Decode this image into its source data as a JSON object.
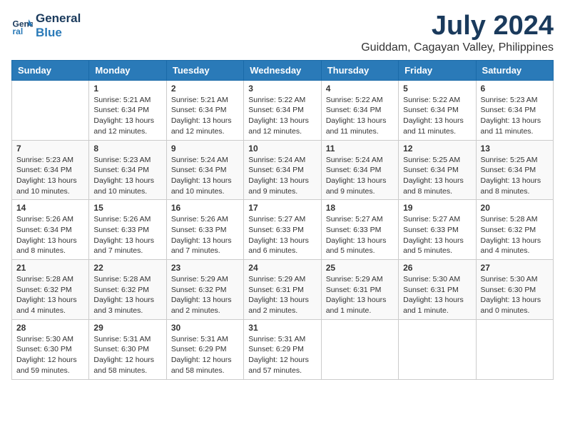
{
  "app": {
    "logo_line1": "General",
    "logo_line2": "Blue"
  },
  "header": {
    "month_year": "July 2024",
    "location": "Guiddam, Cagayan Valley, Philippines"
  },
  "weekdays": [
    "Sunday",
    "Monday",
    "Tuesday",
    "Wednesday",
    "Thursday",
    "Friday",
    "Saturday"
  ],
  "weeks": [
    [
      {
        "day": "",
        "info": ""
      },
      {
        "day": "1",
        "info": "Sunrise: 5:21 AM\nSunset: 6:34 PM\nDaylight: 13 hours\nand 12 minutes."
      },
      {
        "day": "2",
        "info": "Sunrise: 5:21 AM\nSunset: 6:34 PM\nDaylight: 13 hours\nand 12 minutes."
      },
      {
        "day": "3",
        "info": "Sunrise: 5:22 AM\nSunset: 6:34 PM\nDaylight: 13 hours\nand 12 minutes."
      },
      {
        "day": "4",
        "info": "Sunrise: 5:22 AM\nSunset: 6:34 PM\nDaylight: 13 hours\nand 11 minutes."
      },
      {
        "day": "5",
        "info": "Sunrise: 5:22 AM\nSunset: 6:34 PM\nDaylight: 13 hours\nand 11 minutes."
      },
      {
        "day": "6",
        "info": "Sunrise: 5:23 AM\nSunset: 6:34 PM\nDaylight: 13 hours\nand 11 minutes."
      }
    ],
    [
      {
        "day": "7",
        "info": "Sunrise: 5:23 AM\nSunset: 6:34 PM\nDaylight: 13 hours\nand 10 minutes."
      },
      {
        "day": "8",
        "info": "Sunrise: 5:23 AM\nSunset: 6:34 PM\nDaylight: 13 hours\nand 10 minutes."
      },
      {
        "day": "9",
        "info": "Sunrise: 5:24 AM\nSunset: 6:34 PM\nDaylight: 13 hours\nand 10 minutes."
      },
      {
        "day": "10",
        "info": "Sunrise: 5:24 AM\nSunset: 6:34 PM\nDaylight: 13 hours\nand 9 minutes."
      },
      {
        "day": "11",
        "info": "Sunrise: 5:24 AM\nSunset: 6:34 PM\nDaylight: 13 hours\nand 9 minutes."
      },
      {
        "day": "12",
        "info": "Sunrise: 5:25 AM\nSunset: 6:34 PM\nDaylight: 13 hours\nand 8 minutes."
      },
      {
        "day": "13",
        "info": "Sunrise: 5:25 AM\nSunset: 6:34 PM\nDaylight: 13 hours\nand 8 minutes."
      }
    ],
    [
      {
        "day": "14",
        "info": "Sunrise: 5:26 AM\nSunset: 6:34 PM\nDaylight: 13 hours\nand 8 minutes."
      },
      {
        "day": "15",
        "info": "Sunrise: 5:26 AM\nSunset: 6:33 PM\nDaylight: 13 hours\nand 7 minutes."
      },
      {
        "day": "16",
        "info": "Sunrise: 5:26 AM\nSunset: 6:33 PM\nDaylight: 13 hours\nand 7 minutes."
      },
      {
        "day": "17",
        "info": "Sunrise: 5:27 AM\nSunset: 6:33 PM\nDaylight: 13 hours\nand 6 minutes."
      },
      {
        "day": "18",
        "info": "Sunrise: 5:27 AM\nSunset: 6:33 PM\nDaylight: 13 hours\nand 5 minutes."
      },
      {
        "day": "19",
        "info": "Sunrise: 5:27 AM\nSunset: 6:33 PM\nDaylight: 13 hours\nand 5 minutes."
      },
      {
        "day": "20",
        "info": "Sunrise: 5:28 AM\nSunset: 6:32 PM\nDaylight: 13 hours\nand 4 minutes."
      }
    ],
    [
      {
        "day": "21",
        "info": "Sunrise: 5:28 AM\nSunset: 6:32 PM\nDaylight: 13 hours\nand 4 minutes."
      },
      {
        "day": "22",
        "info": "Sunrise: 5:28 AM\nSunset: 6:32 PM\nDaylight: 13 hours\nand 3 minutes."
      },
      {
        "day": "23",
        "info": "Sunrise: 5:29 AM\nSunset: 6:32 PM\nDaylight: 13 hours\nand 2 minutes."
      },
      {
        "day": "24",
        "info": "Sunrise: 5:29 AM\nSunset: 6:31 PM\nDaylight: 13 hours\nand 2 minutes."
      },
      {
        "day": "25",
        "info": "Sunrise: 5:29 AM\nSunset: 6:31 PM\nDaylight: 13 hours\nand 1 minute."
      },
      {
        "day": "26",
        "info": "Sunrise: 5:30 AM\nSunset: 6:31 PM\nDaylight: 13 hours\nand 1 minute."
      },
      {
        "day": "27",
        "info": "Sunrise: 5:30 AM\nSunset: 6:30 PM\nDaylight: 13 hours\nand 0 minutes."
      }
    ],
    [
      {
        "day": "28",
        "info": "Sunrise: 5:30 AM\nSunset: 6:30 PM\nDaylight: 12 hours\nand 59 minutes."
      },
      {
        "day": "29",
        "info": "Sunrise: 5:31 AM\nSunset: 6:30 PM\nDaylight: 12 hours\nand 58 minutes."
      },
      {
        "day": "30",
        "info": "Sunrise: 5:31 AM\nSunset: 6:29 PM\nDaylight: 12 hours\nand 58 minutes."
      },
      {
        "day": "31",
        "info": "Sunrise: 5:31 AM\nSunset: 6:29 PM\nDaylight: 12 hours\nand 57 minutes."
      },
      {
        "day": "",
        "info": ""
      },
      {
        "day": "",
        "info": ""
      },
      {
        "day": "",
        "info": ""
      }
    ]
  ]
}
